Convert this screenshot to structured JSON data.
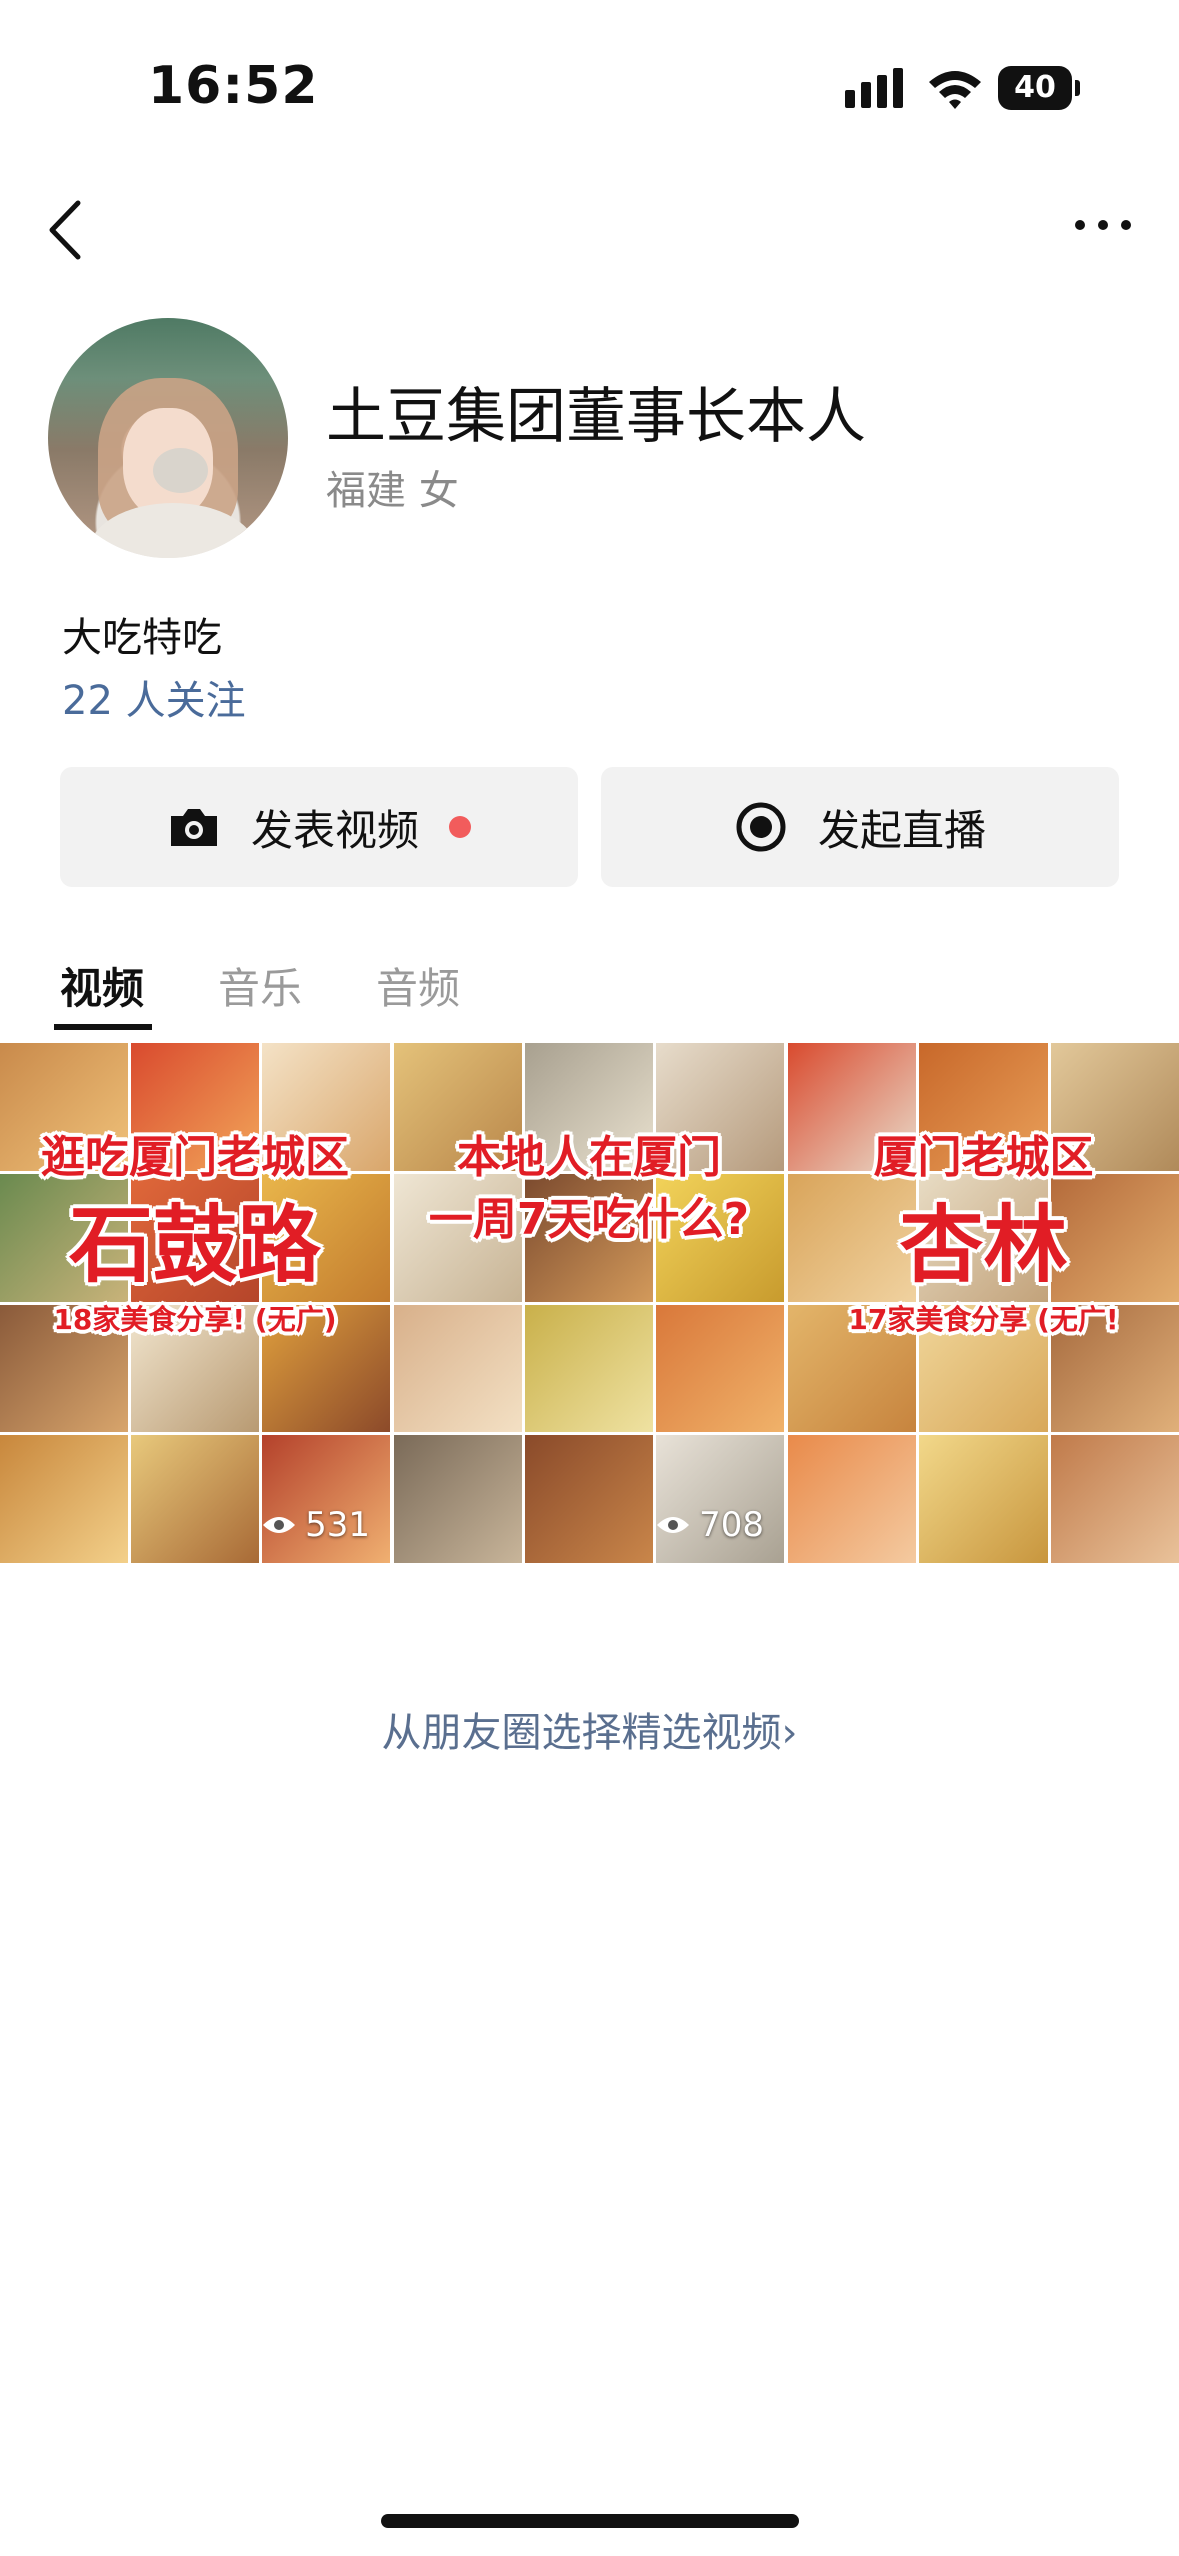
{
  "status_bar": {
    "time": "16:52",
    "battery": "40",
    "icons": [
      "signal-icon",
      "wifi-icon",
      "battery-icon"
    ]
  },
  "nav": {
    "back_icon": "chevron-left-icon",
    "more_icon": "more-dots-icon"
  },
  "profile": {
    "name": "土豆集团董事长本人",
    "meta": "福建 女",
    "signature": "大吃特吃",
    "followers": "22 人关注"
  },
  "actions": {
    "post_video_label": "发表视频",
    "post_video_icon": "camera-icon",
    "go_live_label": "发起直播",
    "go_live_icon": "live-record-icon",
    "accent_dot_color": "#f25c5c"
  },
  "tabs": [
    {
      "label": "视频",
      "active": true
    },
    {
      "label": "音乐",
      "active": false
    },
    {
      "label": "音频",
      "active": false
    }
  ],
  "videos": [
    {
      "line1": "逛吃厦门老城区",
      "line2": "石鼓路",
      "line3": "18家美食分享! (无广)",
      "views": "531"
    },
    {
      "line1": "本地人在厦门",
      "line2": "一周7天吃什么?",
      "line3": "",
      "views": "708"
    },
    {
      "line1": "厦门老城区",
      "line2": "杏林",
      "line3": "17家美食分享 (无广!",
      "views": ""
    }
  ],
  "footer_link": "从朋友圈选择精选视频›",
  "colors": {
    "link": "#4a6b9a",
    "caption_red": "#e11d25",
    "button_bg": "#f2f2f2"
  }
}
